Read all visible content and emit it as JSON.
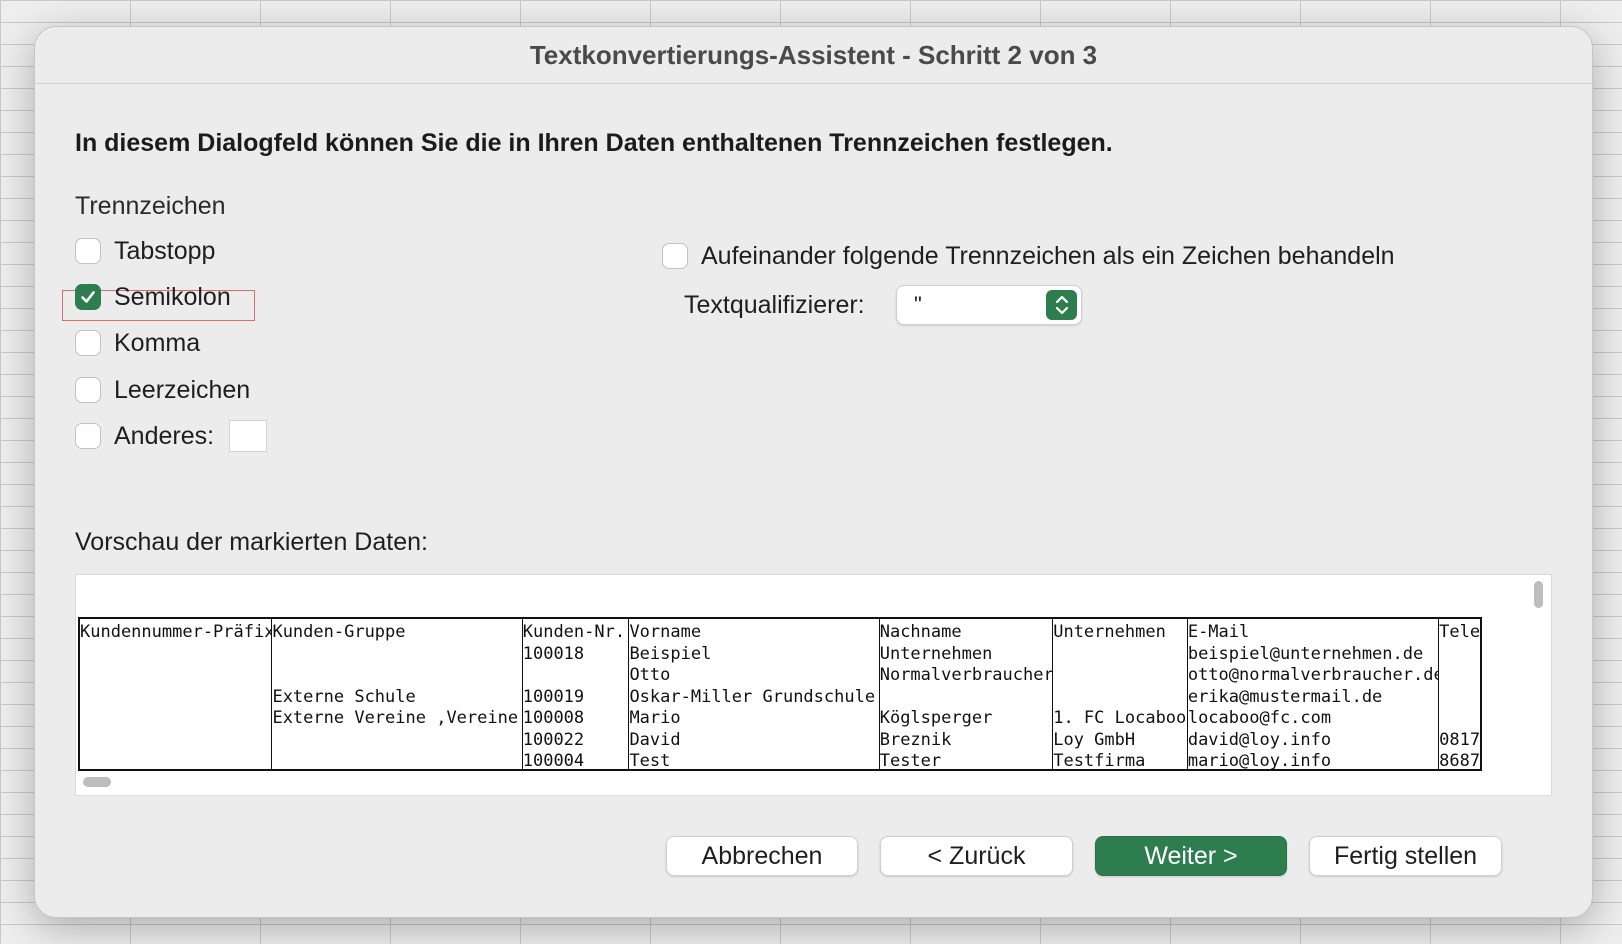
{
  "dialog": {
    "title": "Textkonvertierungs-Assistent - Schritt 2 von 3",
    "instruction": "In diesem Dialogfeld können Sie die in Ihren Daten enthaltenen Trennzeichen festlegen."
  },
  "delimiters": {
    "group_title": "Trennzeichen",
    "options": [
      {
        "label": "Tabstopp",
        "checked": false
      },
      {
        "label": "Semikolon",
        "checked": true
      },
      {
        "label": "Komma",
        "checked": false
      },
      {
        "label": "Leerzeichen",
        "checked": false
      },
      {
        "label": "Anderes:",
        "checked": false
      }
    ],
    "other_value": "",
    "consecutive_label": "Aufeinander folgende Trennzeichen als ein Zeichen behandeln",
    "consecutive_checked": false,
    "qualifier_label": "Textqualifizierer:",
    "qualifier_value": "\""
  },
  "preview": {
    "label": "Vorschau der markierten Daten:",
    "columns": [
      {
        "cells": [
          "Kundennummer-Präfix",
          "",
          "",
          "",
          "",
          "",
          ""
        ]
      },
      {
        "cells": [
          "Kunden-Gruppe",
          "",
          "",
          "Externe Schule",
          "Externe Vereine ,Vereine",
          "",
          ""
        ]
      },
      {
        "cells": [
          "Kunden-Nr.",
          "100018",
          "",
          "100019",
          "100008",
          "100022",
          "100004"
        ]
      },
      {
        "cells": [
          "Vorname",
          "Beispiel",
          "Otto",
          "Oskar-Miller Grundschule",
          "Mario",
          "David",
          "Test"
        ]
      },
      {
        "cells": [
          "Nachname",
          "Unternehmen",
          "Normalverbraucher",
          "",
          "Köglsperger",
          "Breznik",
          "Tester"
        ]
      },
      {
        "cells": [
          "Unternehmen",
          "",
          "",
          "",
          "1. FC Locaboo",
          "Loy GmbH",
          "Testfirma"
        ]
      },
      {
        "cells": [
          "E-Mail",
          "beispiel@unternehmen.de",
          "otto@normalverbraucher.de",
          "erika@mustermail.de",
          "locaboo@fc.com",
          "david@loy.info",
          "mario@loy.info"
        ]
      },
      {
        "cells": [
          "Tele",
          "",
          "",
          "",
          "",
          "0817",
          "8687"
        ]
      }
    ]
  },
  "buttons": {
    "cancel": "Abbrechen",
    "back": "< Zurück",
    "next": "Weiter >",
    "finish": "Fertig stellen"
  },
  "colors": {
    "accent": "#2e7d4f",
    "focus_ring": "#e06b6b"
  },
  "icons": {
    "checkbox_check": "checkmark-icon",
    "select_arrows": "chevron-updown-icon"
  }
}
